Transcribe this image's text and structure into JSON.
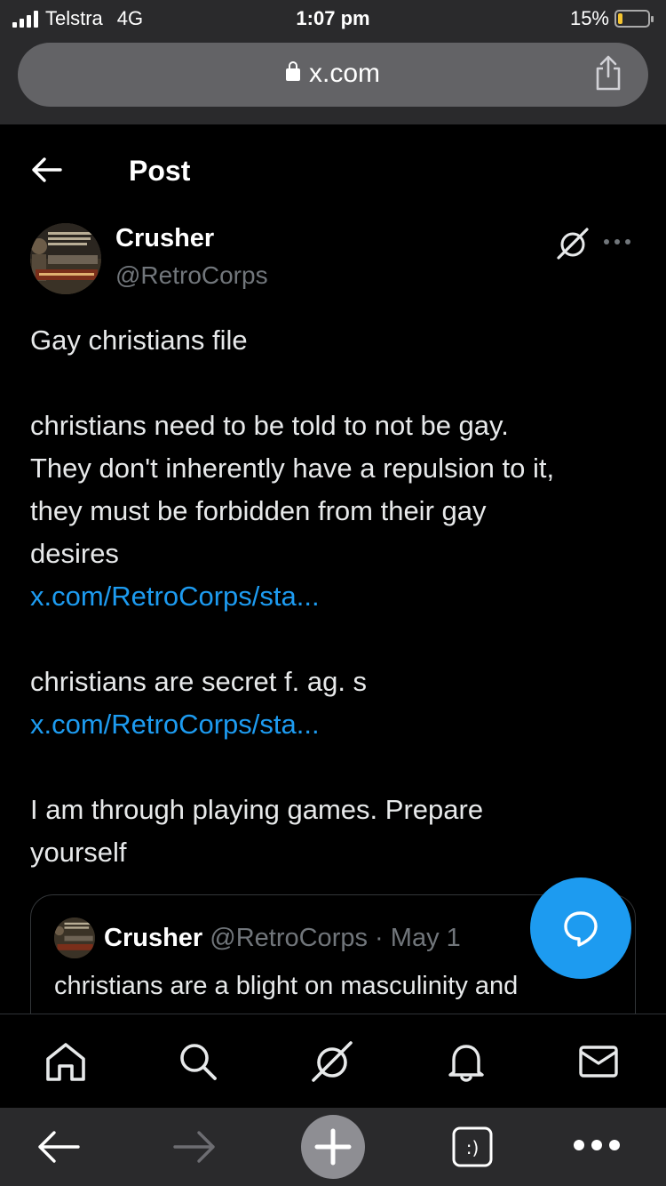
{
  "status_bar": {
    "carrier": "Telstra",
    "network": "4G",
    "time": "1:07 pm",
    "battery_percent": "15%",
    "battery_level": 0.15
  },
  "browser": {
    "url": "x.com"
  },
  "header": {
    "title": "Post"
  },
  "post": {
    "author_name": "Crusher",
    "author_handle": "@RetroCorps",
    "lines": [
      "Gay christians file",
      "christians need to be told to not be gay.",
      "They don't inherently have a repulsion to it,",
      "they must be forbidden from their gay",
      "desires",
      "christians are secret f. ag. s",
      "I am through playing games. Prepare",
      "yourself"
    ],
    "link_1": "x.com/RetroCorps/sta...",
    "link_2": "x.com/RetroCorps/sta..."
  },
  "quote": {
    "author_name": "Crusher",
    "author_handle": "@RetroCorps",
    "separator": "·",
    "date": "May 1",
    "text": "christians are a blight on masculinity and"
  },
  "colors": {
    "accent": "#1d9bf0",
    "secondary_text": "#71767b",
    "battery": "#f4c430"
  },
  "icons": {
    "nav": [
      "home-icon",
      "search-icon",
      "grok-icon",
      "notifications-icon",
      "messages-icon"
    ],
    "safari": [
      "back-arrow-icon",
      "forward-arrow-icon",
      "new-tab-icon",
      "tabs-icon",
      "more-icon"
    ]
  }
}
